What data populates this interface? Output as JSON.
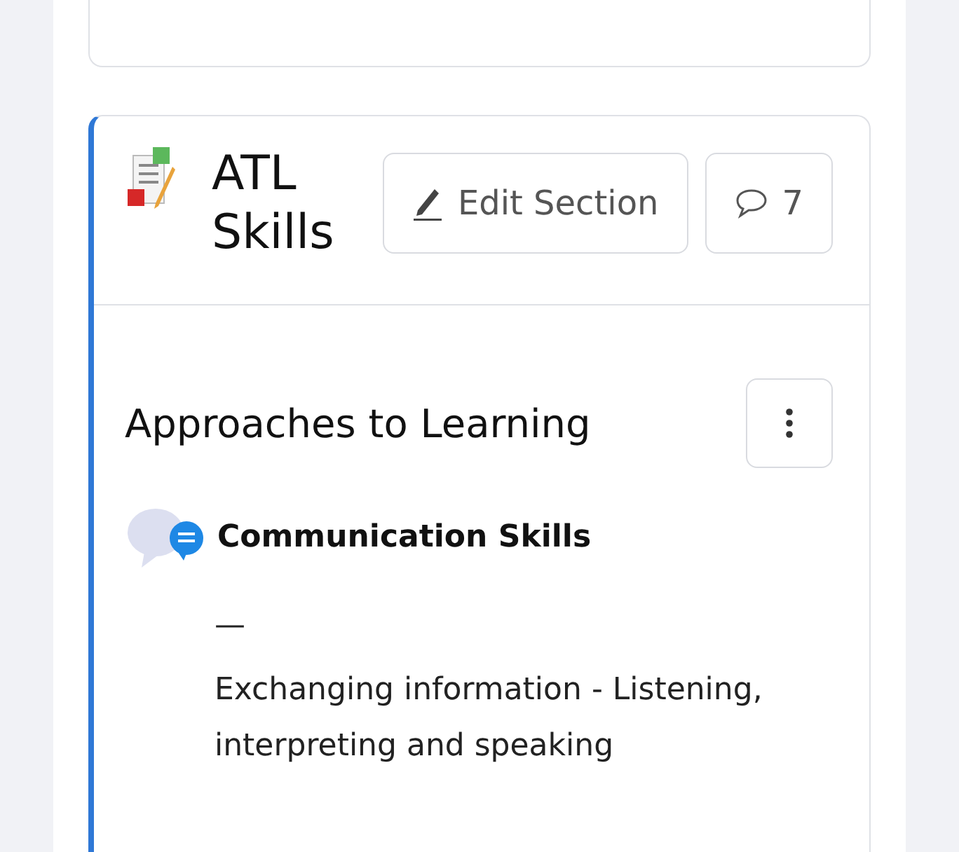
{
  "section": {
    "title": "ATL Skills",
    "edit_button": "Edit Section",
    "comment_count": "7"
  },
  "subsection": {
    "title": "Approaches to Learning"
  },
  "skills": [
    {
      "name": "Communication Skills",
      "separator": "—",
      "description": "Exchanging information - Listening, interpreting and speaking"
    }
  ]
}
